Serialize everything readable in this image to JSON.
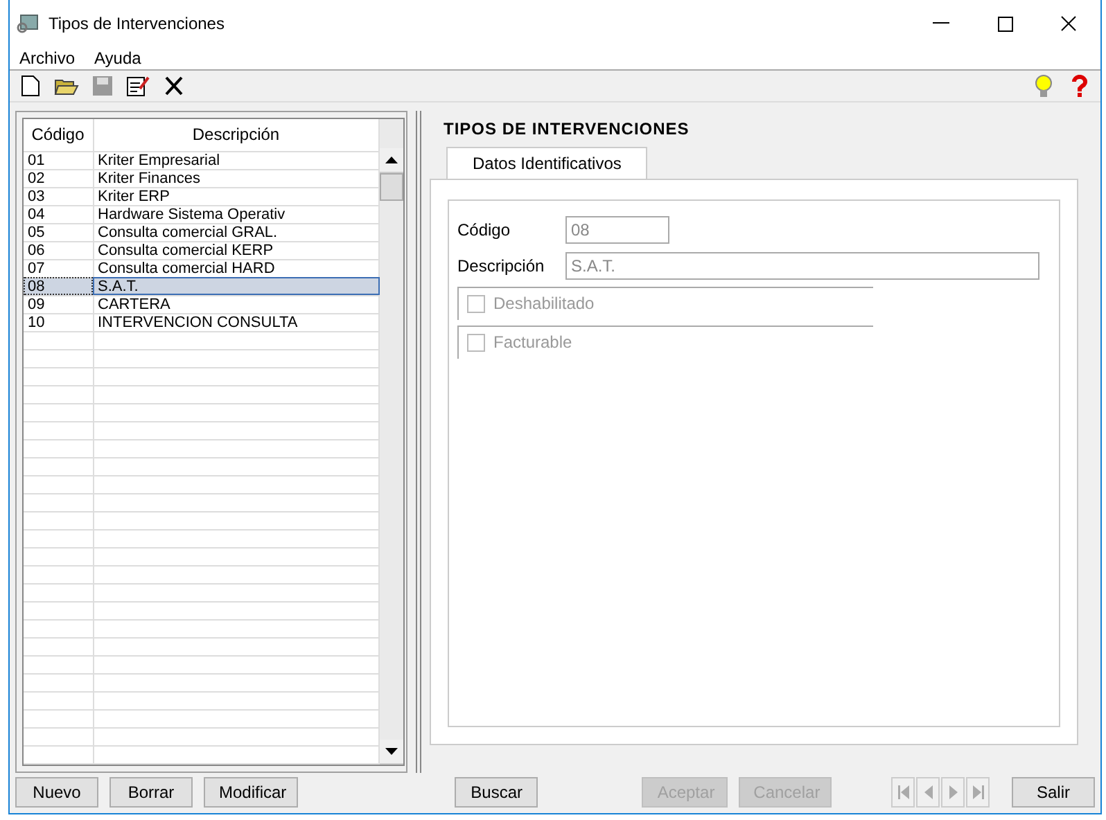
{
  "window": {
    "title": "Tipos de Intervenciones"
  },
  "menu": [
    "Archivo",
    "Ayuda"
  ],
  "toolbar": [
    {
      "kind": "new",
      "disabled": false
    },
    {
      "kind": "open",
      "disabled": false
    },
    {
      "kind": "save",
      "disabled": true
    },
    {
      "kind": "edit",
      "disabled": false
    },
    {
      "kind": "delete",
      "disabled": false
    }
  ],
  "toolbar_right": [
    {
      "kind": "tip"
    },
    {
      "kind": "help"
    }
  ],
  "grid": {
    "columns": [
      "Código",
      "Descripción"
    ],
    "rows": [
      {
        "code": "01",
        "description": "Kriter Empresarial",
        "selected": false
      },
      {
        "code": "02",
        "description": "Kriter Finances",
        "selected": false
      },
      {
        "code": "03",
        "description": "Kriter ERP",
        "selected": false
      },
      {
        "code": "04",
        "description": "Hardware Sistema Operativ",
        "selected": false
      },
      {
        "code": "05",
        "description": "Consulta comercial GRAL.",
        "selected": false
      },
      {
        "code": "06",
        "description": "Consulta comercial KERP",
        "selected": false
      },
      {
        "code": "07",
        "description": "Consulta comercial HARD",
        "selected": false
      },
      {
        "code": "08",
        "description": "S.A.T.",
        "selected": true
      },
      {
        "code": "09",
        "description": "CARTERA",
        "selected": false
      },
      {
        "code": "10",
        "description": "INTERVENCION CONSULTA",
        "selected": false
      }
    ]
  },
  "form": {
    "heading": "TIPOS DE INTERVENCIONES",
    "tabs": [
      {
        "label": "Datos Identificativos",
        "selected": true
      }
    ],
    "fields": [
      {
        "label": "Código",
        "value": "08",
        "wide": false
      },
      {
        "label": "Descripción",
        "value": "S.A.T.",
        "wide": true
      }
    ],
    "checkboxes": [
      {
        "label": "Deshabilitado",
        "checked": false,
        "disabled": true
      },
      {
        "label": "Facturable",
        "checked": false,
        "disabled": true
      }
    ]
  },
  "buttons_left": [
    {
      "label": "Nuevo",
      "disabled": false
    },
    {
      "label": "Borrar",
      "disabled": false
    },
    {
      "label": "Modificar",
      "disabled": false
    }
  ],
  "search_button": {
    "label": "Buscar",
    "disabled": false
  },
  "confirm_buttons": [
    {
      "label": "Aceptar",
      "disabled": true
    },
    {
      "label": "Cancelar",
      "disabled": true
    }
  ],
  "navigator": [
    {
      "kind": "first",
      "disabled": true
    },
    {
      "kind": "prev",
      "disabled": true
    },
    {
      "kind": "next",
      "disabled": true
    },
    {
      "kind": "last",
      "disabled": true
    }
  ],
  "exit_button": {
    "label": "Salir",
    "disabled": false
  }
}
